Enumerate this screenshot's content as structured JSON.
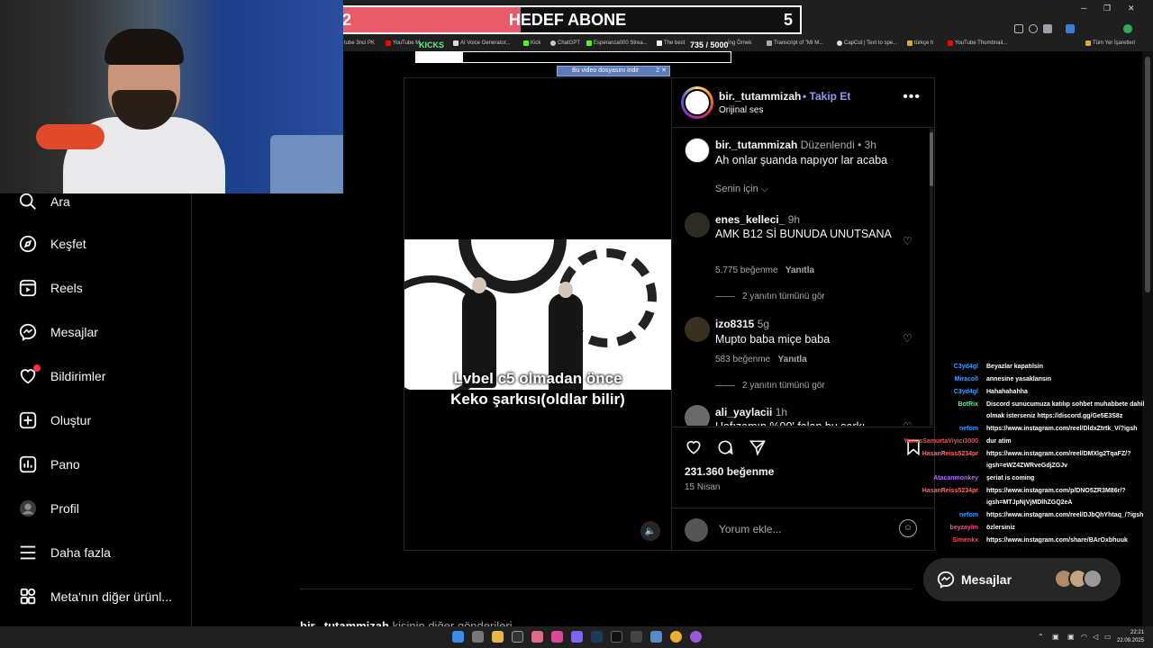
{
  "overlay": {
    "abone_current": "2",
    "abone_title": "HEDEF ABONE",
    "abone_target": "5",
    "abone_progress": 0.4,
    "kicks_label": "KICKS",
    "kicks_count": "735 / 5000",
    "kicks_progress": 0.15,
    "download_bar": "Bu video dosyasını indir",
    "download_close": "2 ✕"
  },
  "bookmarks": [
    "tube 3nci PK",
    "YouTube M",
    "AI Voice Generator...",
    "Kick",
    "ChatGPT",
    "Esperanza000 Strea...",
    "The best",
    "İng Örnek",
    "Transcript of \"MI M...",
    "CapCut | Text to spe...",
    "türkçe h",
    "YouTube Thumbnail...",
    "Tüm Yer İşaretleri"
  ],
  "sidebar": {
    "items": [
      {
        "label": "Ara",
        "icon": "search-icon"
      },
      {
        "label": "Keşfet",
        "icon": "compass-icon"
      },
      {
        "label": "Reels",
        "icon": "reels-icon"
      },
      {
        "label": "Mesajlar",
        "icon": "messenger-icon"
      },
      {
        "label": "Bildirimler",
        "icon": "heart-icon"
      },
      {
        "label": "Oluştur",
        "icon": "plus-square-icon"
      },
      {
        "label": "Pano",
        "icon": "chart-icon"
      },
      {
        "label": "Profil",
        "icon": "profile-avatar-icon"
      },
      {
        "label": "Daha fazla",
        "icon": "menu-icon"
      },
      {
        "label": "Meta'nın diğer ürünl...",
        "icon": "meta-apps-icon"
      }
    ]
  },
  "video": {
    "caption_line1": "Lvbel c5 olmadan önce",
    "caption_line2": "Keko şarkısı(oldlar bilir)",
    "mute_icon": "speaker-icon"
  },
  "post": {
    "username": "bir._tutammizah",
    "follow": "Takip Et",
    "separator": "•",
    "audio": "Orijinal ses",
    "owner_comment": {
      "user": "bir._tutammizah",
      "meta": "Düzenlendi • 3h",
      "text": "Ah onlar şuanda napıyor lar acaba"
    },
    "sort_label": "Senin için",
    "comments": [
      {
        "user": "enes_kelleci_",
        "time": "9h",
        "text": "AMK B12 Sİ BUNUDA UNUTSANA",
        "likes": "5.775 beğenme",
        "reply": "Yanıtla",
        "replies": "2 yanıtın tümünü gör"
      },
      {
        "user": "izo8315",
        "time": "5g",
        "text": "Mupto baba miçe baba",
        "likes": "583 beğenme",
        "reply": "Yanıtla",
        "replies": "2 yanıtın tümünü gör"
      },
      {
        "user": "ali_yaylacii",
        "time": "1h",
        "text": "Hafızamın %90' falan bu şarkı"
      }
    ],
    "like_count": "231.360 beğenme",
    "date": "15 Nisan",
    "comment_placeholder": "Yorum ekle..."
  },
  "chat": [
    {
      "name": "C3yd4gl",
      "color": "#3ea0ff",
      "text": "Beyazlar kapatılsin"
    },
    {
      "name": "Miracoll",
      "color": "#3ea0ff",
      "text": "annesine yasaklansın"
    },
    {
      "name": "C3yd4gl",
      "color": "#3ea0ff",
      "text": "Hahahahahha"
    },
    {
      "name": "BotRix",
      "color": "#5cf08a",
      "text": "Discord sunucumuza katılıp sohbet muhabbete dahil olmak isterseniz https://discord.gg/Ge5E3S8z"
    },
    {
      "name": "nefom",
      "color": "#3ea0ff",
      "text": "https://www.instagram.com/reel/DldxZtrtk_V/?igsh"
    },
    {
      "name": "YunusSamurtaViyici3000",
      "color": "#ff4d4d",
      "text": "dur atim"
    },
    {
      "name": "HasanReiss5234pr",
      "color": "#ff6a6a",
      "text": "https://www.instagram.com/reel/DMXlg2TqaFZ/?igsh=eWZ4ZWRveGdjZGJv"
    },
    {
      "name": "Atacanmonkey",
      "color": "#b36bff",
      "text": "şeriat is coming"
    },
    {
      "name": "HasanReiss5234pr",
      "color": "#ff6a6a",
      "text": "https://www.instagram.com/p/DNO5ZR3M86r/?igsh=MTJpNjVjMDlhZGQ2eA"
    },
    {
      "name": "nefom",
      "color": "#3ea0ff",
      "text": "https://www.instagram.com/reel/DJbQhYhtaq_/?igsh"
    },
    {
      "name": "beyzaylm",
      "color": "#ff4d8a",
      "text": "özlersiniz"
    },
    {
      "name": "Simenkx",
      "color": "#ff4d4d",
      "text": "https://www.instagram.com/share/BArOxbhuuk"
    }
  ],
  "messages_pill": {
    "label": "Mesajlar"
  },
  "more_from": {
    "user": "bir._tutammizah",
    "text": "kişinin diğer gönderileri"
  },
  "clock": {
    "time": "22:21",
    "date": "22.09.2025"
  },
  "colors": {
    "accent": "#8e9cf5",
    "notification": "#ff3040",
    "abone_fill": "#e85c6a"
  }
}
